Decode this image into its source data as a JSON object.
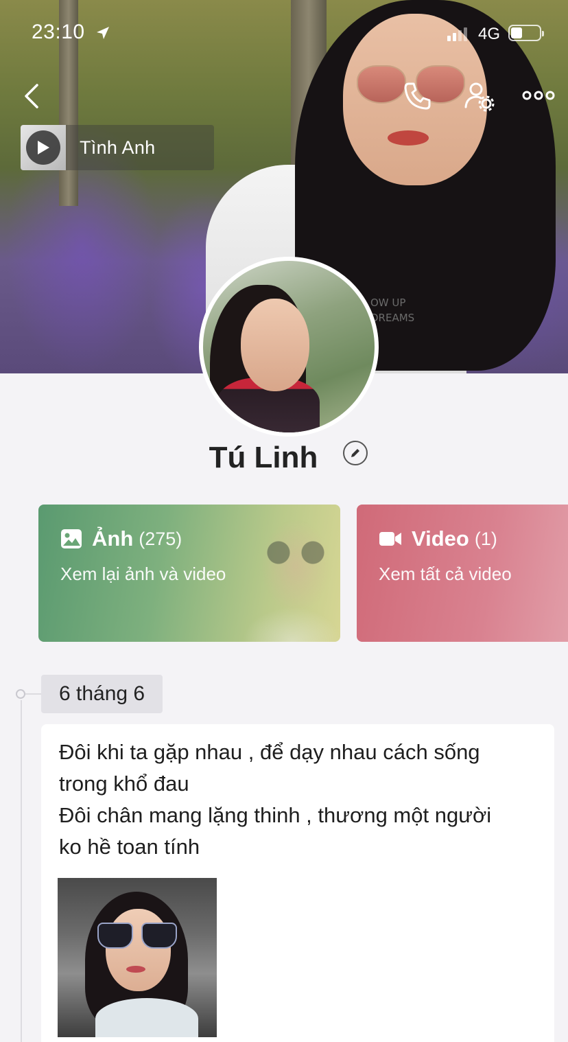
{
  "status_bar": {
    "time": "23:10",
    "network": "4G"
  },
  "music": {
    "title": "Tình Anh"
  },
  "profile": {
    "name": "Tú Linh"
  },
  "media": {
    "photos": {
      "title": "Ảnh",
      "count": "(275)",
      "subtitle": "Xem lại ảnh và video"
    },
    "videos": {
      "title": "Video",
      "count": "(1)",
      "subtitle": "Xem tất cả video"
    }
  },
  "timeline": {
    "date": "6 tháng 6",
    "post_text": "Đôi khi ta gặp nhau , để dạy nhau cách sống\ntrong khổ đau\nĐôi chân mang lặng thinh , thương một người\nko hề toan tính"
  },
  "icons": {
    "back": "chevron-left-icon",
    "call": "phone-icon",
    "settings": "user-settings-icon",
    "more": "more-dots-icon",
    "play": "play-icon",
    "edit": "pencil-icon",
    "photo": "image-icon",
    "video": "video-camera-icon"
  },
  "colors": {
    "photos_card": "#6aa676",
    "videos_card": "#d4707e",
    "background": "#f4f3f6"
  }
}
